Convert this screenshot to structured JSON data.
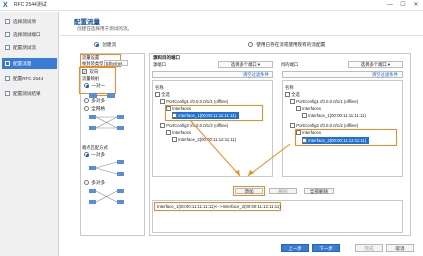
{
  "window": {
    "title": "RFC 2544测试",
    "logo": "X",
    "minimize": "—",
    "maximize": "☐",
    "close": "✕"
  },
  "sidebar": {
    "items": [
      {
        "label": "选择测试项"
      },
      {
        "label": "选择测试端口"
      },
      {
        "label": "配置测试流"
      },
      {
        "label": "配置流量"
      },
      {
        "label": "配置RFC 2544"
      },
      {
        "label": "配置测试结果"
      }
    ]
  },
  "header": {
    "title": "配置流量",
    "subtitle": "创建在选择用于测试的流。"
  },
  "mode": {
    "create": "创建流",
    "use_existing": "使用已存在流或使用现有的流配置"
  },
  "left_panel": {
    "protocol_label": "流量设置",
    "type_label": "帧封装类型",
    "type_value": "Ethernet",
    "bidirectional": "双向",
    "mapping_label": "流量映射",
    "one_to_one": "一对一",
    "many_to_many": "多对多",
    "full_mesh": "全网格",
    "port_pair_label": "端点匹配方式",
    "pair_option": "一对多",
    "multi_option": "多对多"
  },
  "right_panel": {
    "title": "源和目的端口",
    "src_label": "源端口",
    "dst_label": "目的端口",
    "select_dropdown": "选择多个端口",
    "filter_link": "清空过滤条件",
    "tree_header": "名称",
    "src_tree": [
      {
        "label": "全选"
      },
      {
        "label": "PortConfig1 //0.0.0.0/1/1 (offline)"
      },
      {
        "label": "Interfaces"
      },
      {
        "label": "Interface_1(00:00:11:11:11:11)"
      },
      {
        "label": "PortConfig2 //0.0.0.0/1/2 (offline)"
      },
      {
        "label": "Interfaces"
      },
      {
        "label": "Interface_2(00:00:11:12:11:11)"
      }
    ],
    "dst_tree": [
      {
        "label": "全选"
      },
      {
        "label": "PortConfig1 //0.0.0.0/1/1 (offline)"
      },
      {
        "label": "Interfaces"
      },
      {
        "label": "Interface_1(00:00:11:11:11:11)"
      },
      {
        "label": "PortConfig2 //0.0.0.0/1/2 (offline)"
      },
      {
        "label": "Interfaces"
      },
      {
        "label": "Interface_2(00:00:11:12:11:11)"
      }
    ],
    "add_btn": "添加",
    "delete_btn": "删除",
    "delete_all_btn": "全部删除",
    "result_entry": "Interface_1(00:00:11:11:11:11)<-->Interface_2(00:00:11:12:11:11)"
  },
  "footer": {
    "prev": "上一步",
    "next": "下一步",
    "finish": "完成",
    "cancel": "取消"
  },
  "colors": {
    "accent": "#3a7bd5",
    "highlight": "#f08a24"
  }
}
